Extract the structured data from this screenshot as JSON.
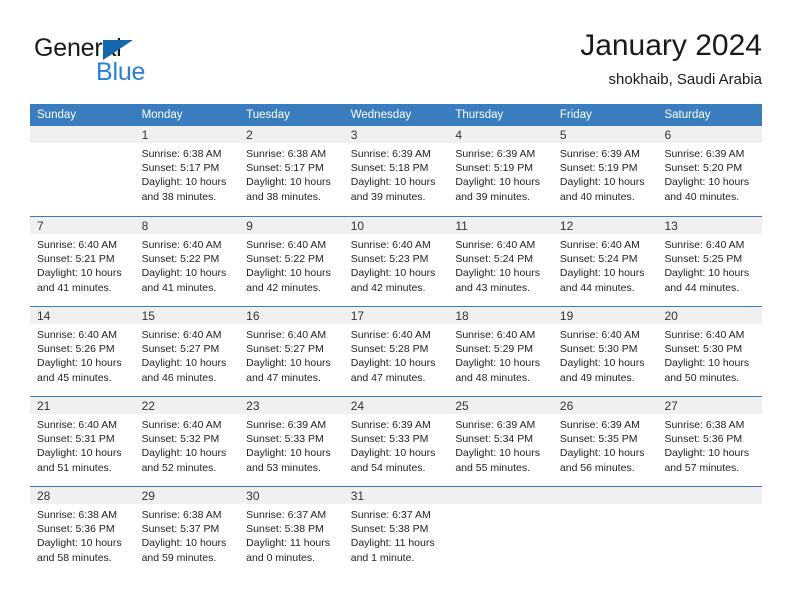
{
  "brand": {
    "word_one": "General",
    "word_two": "Blue",
    "triangle_color": "#1567b0",
    "blue_text_color": "#2a7fd4",
    "logo_icon": "triangle-flag-icon"
  },
  "header": {
    "title": "January 2024",
    "subtitle": "shokhaib, Saudi Arabia"
  },
  "calendar": {
    "header_bg": "#3a7dbf",
    "day_band_bg": "#f0f0f0",
    "weekdays": [
      "Sunday",
      "Monday",
      "Tuesday",
      "Wednesday",
      "Thursday",
      "Friday",
      "Saturday"
    ],
    "weeks": [
      [
        {
          "day": "",
          "sunrise": "",
          "sunset": "",
          "daylight_line1": "",
          "daylight_line2": ""
        },
        {
          "day": "1",
          "sunrise": "Sunrise: 6:38 AM",
          "sunset": "Sunset: 5:17 PM",
          "daylight_line1": "Daylight: 10 hours",
          "daylight_line2": "and 38 minutes."
        },
        {
          "day": "2",
          "sunrise": "Sunrise: 6:38 AM",
          "sunset": "Sunset: 5:17 PM",
          "daylight_line1": "Daylight: 10 hours",
          "daylight_line2": "and 38 minutes."
        },
        {
          "day": "3",
          "sunrise": "Sunrise: 6:39 AM",
          "sunset": "Sunset: 5:18 PM",
          "daylight_line1": "Daylight: 10 hours",
          "daylight_line2": "and 39 minutes."
        },
        {
          "day": "4",
          "sunrise": "Sunrise: 6:39 AM",
          "sunset": "Sunset: 5:19 PM",
          "daylight_line1": "Daylight: 10 hours",
          "daylight_line2": "and 39 minutes."
        },
        {
          "day": "5",
          "sunrise": "Sunrise: 6:39 AM",
          "sunset": "Sunset: 5:19 PM",
          "daylight_line1": "Daylight: 10 hours",
          "daylight_line2": "and 40 minutes."
        },
        {
          "day": "6",
          "sunrise": "Sunrise: 6:39 AM",
          "sunset": "Sunset: 5:20 PM",
          "daylight_line1": "Daylight: 10 hours",
          "daylight_line2": "and 40 minutes."
        }
      ],
      [
        {
          "day": "7",
          "sunrise": "Sunrise: 6:40 AM",
          "sunset": "Sunset: 5:21 PM",
          "daylight_line1": "Daylight: 10 hours",
          "daylight_line2": "and 41 minutes."
        },
        {
          "day": "8",
          "sunrise": "Sunrise: 6:40 AM",
          "sunset": "Sunset: 5:22 PM",
          "daylight_line1": "Daylight: 10 hours",
          "daylight_line2": "and 41 minutes."
        },
        {
          "day": "9",
          "sunrise": "Sunrise: 6:40 AM",
          "sunset": "Sunset: 5:22 PM",
          "daylight_line1": "Daylight: 10 hours",
          "daylight_line2": "and 42 minutes."
        },
        {
          "day": "10",
          "sunrise": "Sunrise: 6:40 AM",
          "sunset": "Sunset: 5:23 PM",
          "daylight_line1": "Daylight: 10 hours",
          "daylight_line2": "and 42 minutes."
        },
        {
          "day": "11",
          "sunrise": "Sunrise: 6:40 AM",
          "sunset": "Sunset: 5:24 PM",
          "daylight_line1": "Daylight: 10 hours",
          "daylight_line2": "and 43 minutes."
        },
        {
          "day": "12",
          "sunrise": "Sunrise: 6:40 AM",
          "sunset": "Sunset: 5:24 PM",
          "daylight_line1": "Daylight: 10 hours",
          "daylight_line2": "and 44 minutes."
        },
        {
          "day": "13",
          "sunrise": "Sunrise: 6:40 AM",
          "sunset": "Sunset: 5:25 PM",
          "daylight_line1": "Daylight: 10 hours",
          "daylight_line2": "and 44 minutes."
        }
      ],
      [
        {
          "day": "14",
          "sunrise": "Sunrise: 6:40 AM",
          "sunset": "Sunset: 5:26 PM",
          "daylight_line1": "Daylight: 10 hours",
          "daylight_line2": "and 45 minutes."
        },
        {
          "day": "15",
          "sunrise": "Sunrise: 6:40 AM",
          "sunset": "Sunset: 5:27 PM",
          "daylight_line1": "Daylight: 10 hours",
          "daylight_line2": "and 46 minutes."
        },
        {
          "day": "16",
          "sunrise": "Sunrise: 6:40 AM",
          "sunset": "Sunset: 5:27 PM",
          "daylight_line1": "Daylight: 10 hours",
          "daylight_line2": "and 47 minutes."
        },
        {
          "day": "17",
          "sunrise": "Sunrise: 6:40 AM",
          "sunset": "Sunset: 5:28 PM",
          "daylight_line1": "Daylight: 10 hours",
          "daylight_line2": "and 47 minutes."
        },
        {
          "day": "18",
          "sunrise": "Sunrise: 6:40 AM",
          "sunset": "Sunset: 5:29 PM",
          "daylight_line1": "Daylight: 10 hours",
          "daylight_line2": "and 48 minutes."
        },
        {
          "day": "19",
          "sunrise": "Sunrise: 6:40 AM",
          "sunset": "Sunset: 5:30 PM",
          "daylight_line1": "Daylight: 10 hours",
          "daylight_line2": "and 49 minutes."
        },
        {
          "day": "20",
          "sunrise": "Sunrise: 6:40 AM",
          "sunset": "Sunset: 5:30 PM",
          "daylight_line1": "Daylight: 10 hours",
          "daylight_line2": "and 50 minutes."
        }
      ],
      [
        {
          "day": "21",
          "sunrise": "Sunrise: 6:40 AM",
          "sunset": "Sunset: 5:31 PM",
          "daylight_line1": "Daylight: 10 hours",
          "daylight_line2": "and 51 minutes."
        },
        {
          "day": "22",
          "sunrise": "Sunrise: 6:40 AM",
          "sunset": "Sunset: 5:32 PM",
          "daylight_line1": "Daylight: 10 hours",
          "daylight_line2": "and 52 minutes."
        },
        {
          "day": "23",
          "sunrise": "Sunrise: 6:39 AM",
          "sunset": "Sunset: 5:33 PM",
          "daylight_line1": "Daylight: 10 hours",
          "daylight_line2": "and 53 minutes."
        },
        {
          "day": "24",
          "sunrise": "Sunrise: 6:39 AM",
          "sunset": "Sunset: 5:33 PM",
          "daylight_line1": "Daylight: 10 hours",
          "daylight_line2": "and 54 minutes."
        },
        {
          "day": "25",
          "sunrise": "Sunrise: 6:39 AM",
          "sunset": "Sunset: 5:34 PM",
          "daylight_line1": "Daylight: 10 hours",
          "daylight_line2": "and 55 minutes."
        },
        {
          "day": "26",
          "sunrise": "Sunrise: 6:39 AM",
          "sunset": "Sunset: 5:35 PM",
          "daylight_line1": "Daylight: 10 hours",
          "daylight_line2": "and 56 minutes."
        },
        {
          "day": "27",
          "sunrise": "Sunrise: 6:38 AM",
          "sunset": "Sunset: 5:36 PM",
          "daylight_line1": "Daylight: 10 hours",
          "daylight_line2": "and 57 minutes."
        }
      ],
      [
        {
          "day": "28",
          "sunrise": "Sunrise: 6:38 AM",
          "sunset": "Sunset: 5:36 PM",
          "daylight_line1": "Daylight: 10 hours",
          "daylight_line2": "and 58 minutes."
        },
        {
          "day": "29",
          "sunrise": "Sunrise: 6:38 AM",
          "sunset": "Sunset: 5:37 PM",
          "daylight_line1": "Daylight: 10 hours",
          "daylight_line2": "and 59 minutes."
        },
        {
          "day": "30",
          "sunrise": "Sunrise: 6:37 AM",
          "sunset": "Sunset: 5:38 PM",
          "daylight_line1": "Daylight: 11 hours",
          "daylight_line2": "and 0 minutes."
        },
        {
          "day": "31",
          "sunrise": "Sunrise: 6:37 AM",
          "sunset": "Sunset: 5:38 PM",
          "daylight_line1": "Daylight: 11 hours",
          "daylight_line2": "and 1 minute."
        },
        {
          "day": "",
          "sunrise": "",
          "sunset": "",
          "daylight_line1": "",
          "daylight_line2": ""
        },
        {
          "day": "",
          "sunrise": "",
          "sunset": "",
          "daylight_line1": "",
          "daylight_line2": ""
        },
        {
          "day": "",
          "sunrise": "",
          "sunset": "",
          "daylight_line1": "",
          "daylight_line2": ""
        }
      ]
    ]
  }
}
